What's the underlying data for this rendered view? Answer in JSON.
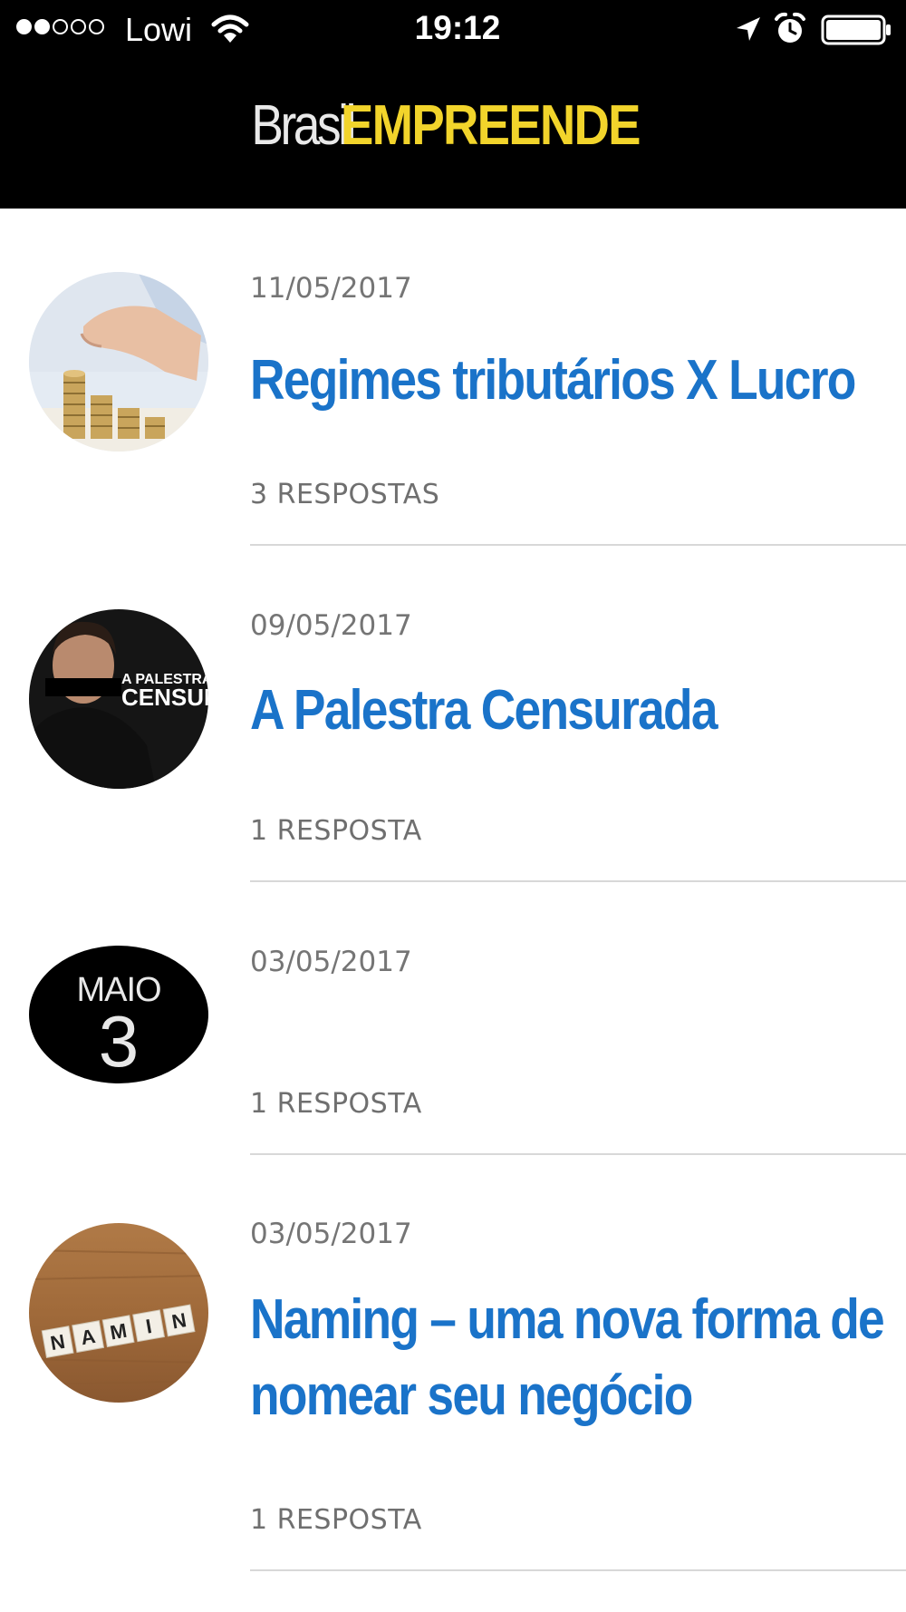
{
  "status_bar": {
    "carrier": "Lowi",
    "time": "19:12",
    "signal_bars_filled": 2,
    "signal_bars_total": 5
  },
  "header": {
    "logo_part1": "Brasil",
    "logo_part2": "EMPREENDE",
    "logo_accent_color": "#f2d42b"
  },
  "posts": [
    {
      "date": "11/05/2017",
      "title_lines": [
        "Regimes tributários X Lucro"
      ],
      "replies": "3 RESPOSTAS",
      "thumbnail": "coins-stack-image"
    },
    {
      "date": "09/05/2017",
      "title_lines": [
        "A Palestra Censurada"
      ],
      "replies": "1 RESPOSTA",
      "thumbnail": "censored-speaker-image",
      "thumbnail_text_1": "A PALESTRA",
      "thumbnail_text_2": "CENSUR"
    },
    {
      "date": "03/05/2017",
      "title_lines": [],
      "replies": "1 RESPOSTA",
      "thumbnail": "calendar-date-image",
      "calendar_month": "MAIO",
      "calendar_day": "3"
    },
    {
      "date": "03/05/2017",
      "title_lines": [
        "Naming – uma nova forma de",
        "nomear seu negócio"
      ],
      "replies": "1 RESPOSTA",
      "thumbnail": "letter-tiles-image",
      "tiles": [
        "N",
        "A",
        "M",
        "I",
        "N"
      ]
    }
  ],
  "colors": {
    "title_blue": "#1a73c9",
    "meta_gray": "#757575",
    "header_bg": "#000000"
  }
}
